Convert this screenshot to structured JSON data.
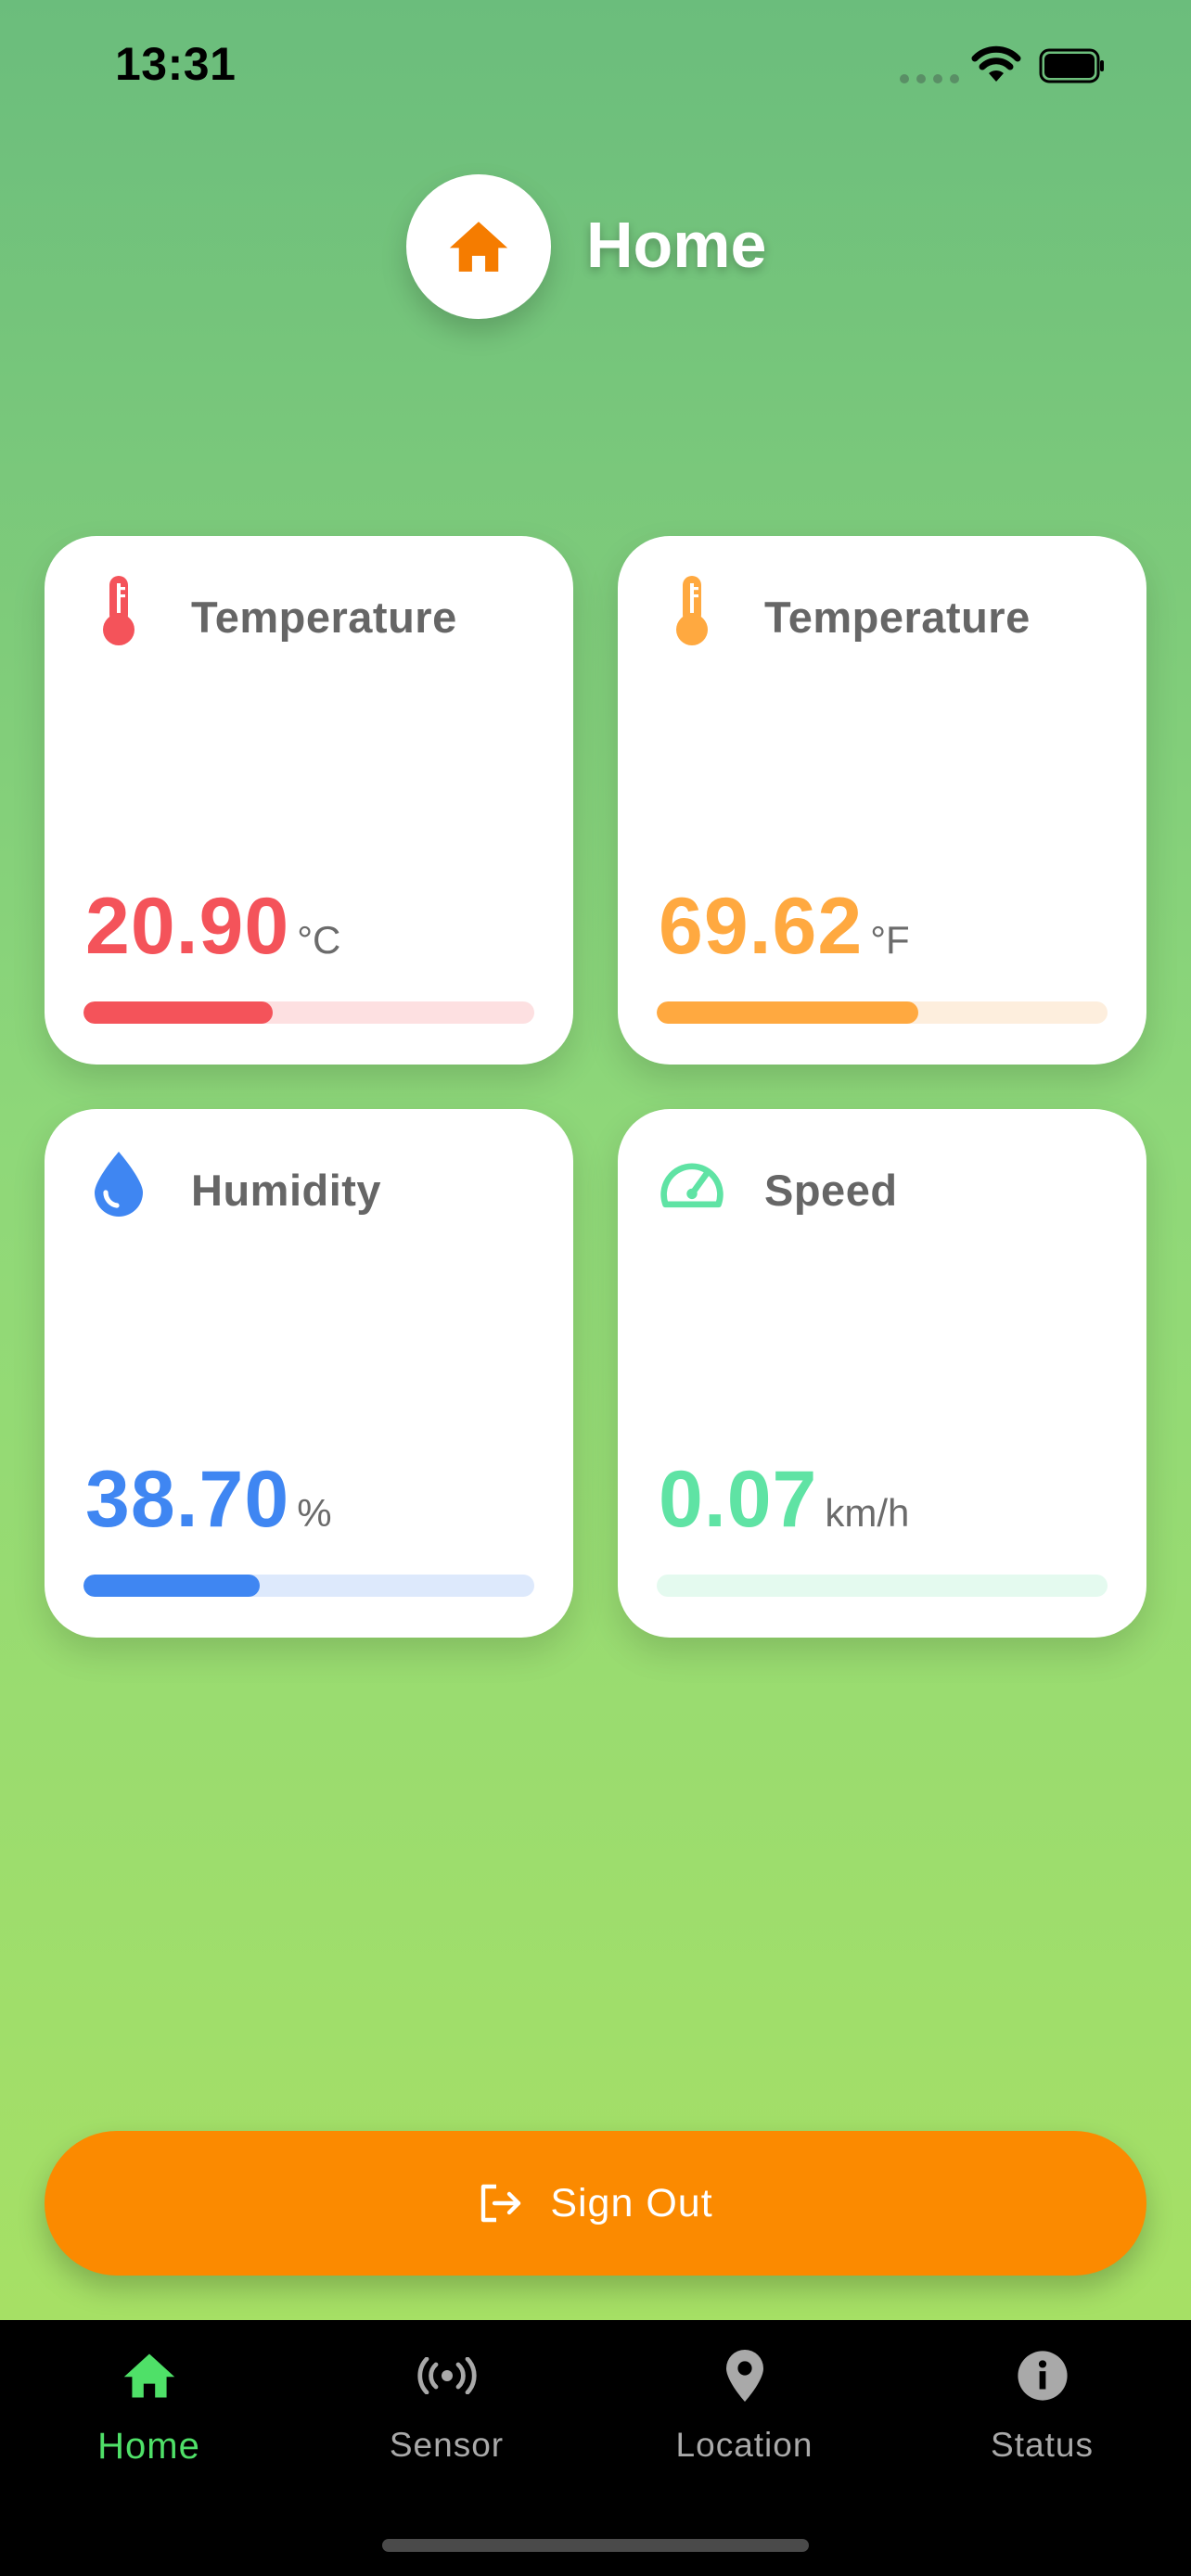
{
  "status_bar": {
    "time": "13:31"
  },
  "header": {
    "title": "Home",
    "icon": "home-icon",
    "accent": "#f57c00"
  },
  "cards": [
    {
      "id": "temperature-c",
      "icon": "thermometer-icon",
      "title": "Temperature",
      "value": "20.90",
      "unit": "°C",
      "color": "#f4535a",
      "track": "#fde0e1",
      "progress": 0.42
    },
    {
      "id": "temperature-f",
      "icon": "thermometer-icon",
      "title": "Temperature",
      "value": "69.62",
      "unit": "°F",
      "color": "#ffa940",
      "track": "#fdeedd",
      "progress": 0.58
    },
    {
      "id": "humidity",
      "icon": "water-drop-icon",
      "title": "Humidity",
      "value": "38.70",
      "unit": "%",
      "color": "#3f86f2",
      "track": "#dde9fc",
      "progress": 0.39
    },
    {
      "id": "speed",
      "icon": "speedometer-icon",
      "title": "Speed",
      "value": "0.07",
      "unit": "km/h",
      "color": "#5fe3a4",
      "track": "#e4faef",
      "progress": 0.0
    }
  ],
  "signout": {
    "label": "Sign Out",
    "icon": "logout-icon",
    "color": "#fb8a00"
  },
  "tabbar": {
    "active": "Home",
    "active_color": "#4fe068",
    "items": [
      {
        "label": "Home",
        "icon": "home-icon"
      },
      {
        "label": "Sensor",
        "icon": "sensor-icon"
      },
      {
        "label": "Location",
        "icon": "location-pin-icon"
      },
      {
        "label": "Status",
        "icon": "info-icon"
      }
    ]
  }
}
